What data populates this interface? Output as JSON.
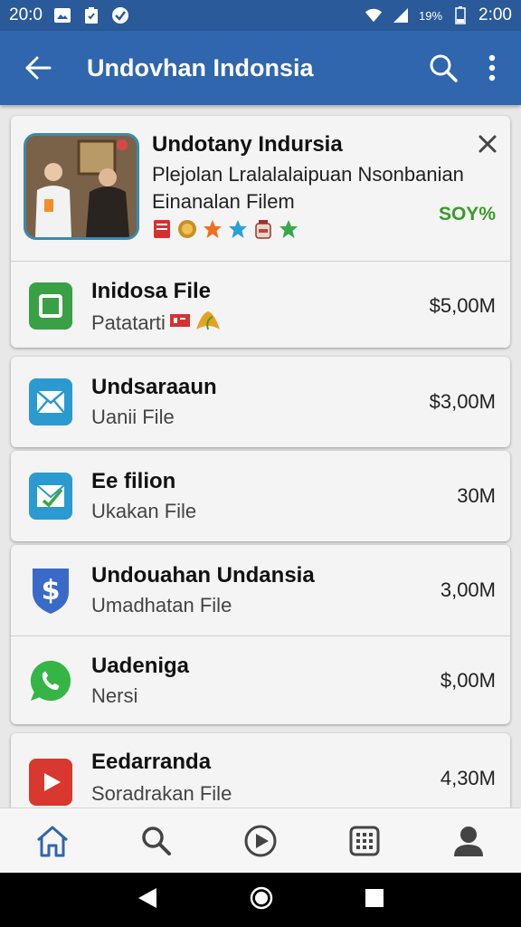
{
  "status_bar": {
    "time_left": "20:0",
    "battery_pct": "19%",
    "time_right": "2:00"
  },
  "app_bar": {
    "title": "Undovhan Indonsia"
  },
  "featured": {
    "title": "Undotany Indursia",
    "description_line1": "Plejolan Lralalalaipuan Nsonbanian",
    "description_line2": "Einanalan Filem",
    "percent": "SOY%"
  },
  "items": [
    {
      "name": "Inidosa File",
      "subtitle": "Patatarti",
      "size": "$5,00M",
      "icon": "green-square-icon",
      "color": "#3aa046"
    },
    {
      "name": "Undsaraaun",
      "subtitle": "Uanii File",
      "size": "$3,00M",
      "icon": "mail-icon",
      "color": "#2a9ad0"
    },
    {
      "name": "Ee filion",
      "subtitle": "Ukakan File",
      "size": "30M",
      "icon": "mail-check-icon",
      "color": "#2a9ad0"
    },
    {
      "name": "Undouahan Undansia",
      "subtitle": "Umadhatan File",
      "size": "3,00M",
      "icon": "dollar-shield-icon",
      "color": "#3a6ac8"
    },
    {
      "name": "Uadeniga",
      "subtitle": "Nersi",
      "size": "$,00M",
      "icon": "whatsapp-icon",
      "color": "#35b545"
    },
    {
      "name": "Eedarranda",
      "subtitle": "Soradrakan File",
      "size": "4,30M",
      "icon": "youtube-icon",
      "color": "#d8382e"
    }
  ]
}
